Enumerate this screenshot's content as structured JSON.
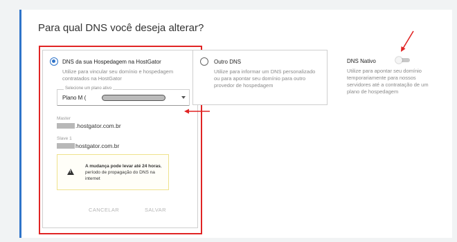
{
  "page": {
    "title": "Para qual DNS você deseja alterar?"
  },
  "hostgator_option": {
    "title": "DNS da sua Hospedagem na HostGator",
    "selected": true,
    "description": "Utilize para vincular seu domínio e hospedagem contratados na HostGator",
    "select": {
      "legend": "Selecione um plano ativo",
      "value": "Plano M ("
    },
    "master": {
      "label": "Master",
      "value": ".hostgator.com.br"
    },
    "slave": {
      "label": "Slave 1",
      "value": "hostgator.com.br"
    },
    "warning": {
      "bold": "A mudança pode levar até 24 horas",
      "rest": ", período de propagação do DNS na internet"
    },
    "cancel_label": "CANCELAR",
    "save_label": "SALVAR"
  },
  "other_option": {
    "title": "Outro DNS",
    "selected": false,
    "description": "Utilize para informar um DNS personalizado ou para apontar seu domínio para outro provedor de hospedagem"
  },
  "native_option": {
    "title": "DNS Nativo",
    "enabled": false,
    "description": "Utilize para apontar seu domínio temporariamente para nossos servidores até a contratação de um plano de hospedagem"
  },
  "colors": {
    "accent": "#2f74c9",
    "highlight": "#e02424",
    "warning_border": "#efe28c"
  }
}
